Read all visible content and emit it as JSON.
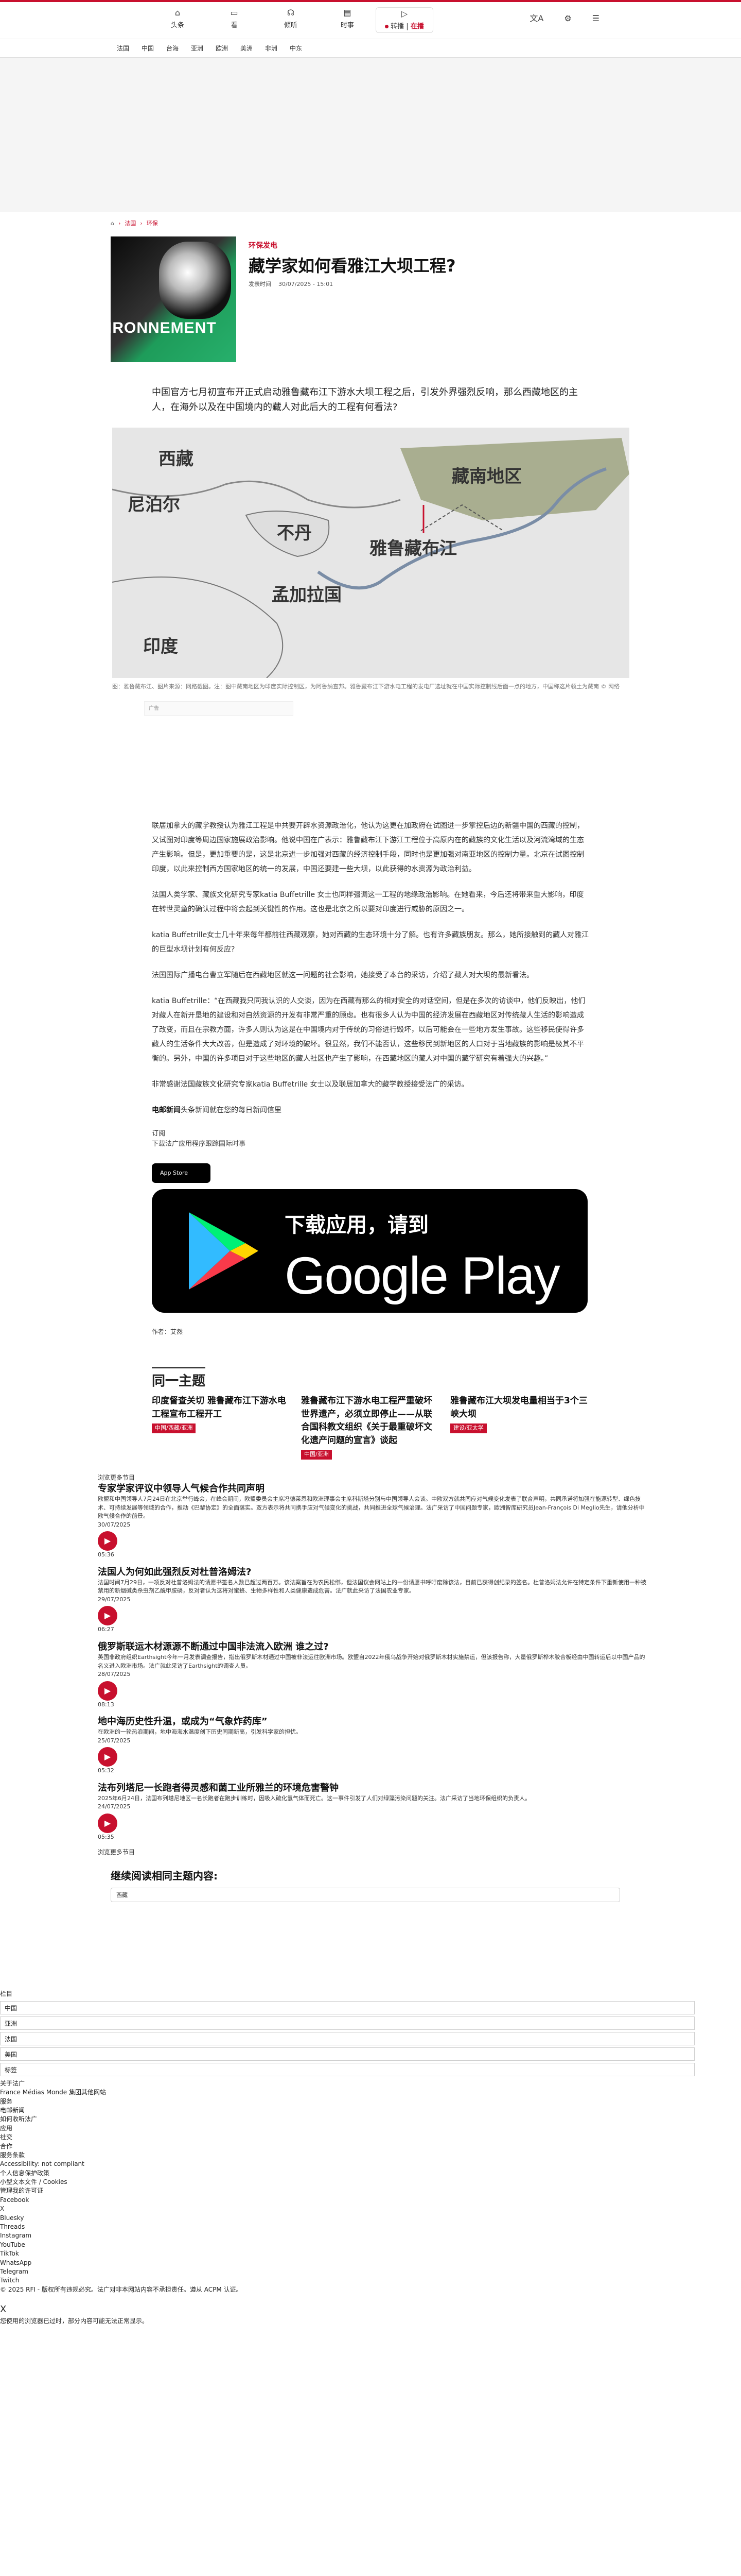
{
  "topnav": {
    "items": [
      {
        "label": "头条",
        "icon": "home-icon"
      },
      {
        "label": "看",
        "icon": "tv-icon"
      },
      {
        "label": "倾听",
        "icon": "headphones-icon"
      },
      {
        "label": "时事",
        "icon": "newspaper-icon"
      }
    ],
    "live_label": "在播",
    "live_prefix": "转播"
  },
  "topright": {
    "lang_icon": "translate-icon",
    "settings_icon": "gear-icon",
    "menu_icon": "hamburger-icon"
  },
  "secnav": [
    "法国",
    "中国",
    "台海",
    "亚洲",
    "欧洲",
    "美洲",
    "非洲",
    "中东"
  ],
  "breadcrumb": {
    "home_icon": "home-icon",
    "items": [
      "法国",
      "环保"
    ]
  },
  "article": {
    "kicker": "环保发电",
    "title": "藏学家如何看雅江大坝工程?",
    "date_label": "发表时间",
    "date": "30/07/2025 - 15:01",
    "thumb_text": "IRONNEMENT",
    "lead": "中国官方七月初宣布开正式启动雅鲁藏布江下游水大坝工程之后，引发外界强烈反响，那么西藏地区的主人，在海外以及在中国境内的藏人对此后大的工程有何看法?",
    "map_labels": [
      "西藏",
      "藏南地区",
      "尼泊尔",
      "不丹",
      "雅鲁藏布江",
      "孟加拉国",
      "印度"
    ],
    "caption": "图：雅鲁藏布江、图片来源：网路截图。注：图中藏南地区为印度实际控制区，为阿鲁纳查邦。雅鲁藏布江下游水电工程的发电厂选址就在中国实际控制线后面一点的地方，中国称这片领土为藏南 © 网络",
    "ad_label": "广告",
    "paragraphs": [
      "联居加拿大的藏学教授认为雅江工程是中共要开辟水资源政治化，他认为这更在加政府在试图进一步掌控后边的新疆中国的西藏的控制，又试图对印度等周边国家施展政治影响。他说中国在广表示：雅鲁藏布江下游江工程位于高原内在的藏族的文化生活以及河流湾域的生态产生影响。但是，更加重要的是，这是北京进一步加强对西藏的经济控制手段，同时也是更加强对南亚地区的控制力量。北京在试图控制印度，以此来控制西方国家地区的统一的发展，中国还要建一些大坝，以此获得的水资源为政治利益。",
      "法国人类学家、藏族文化研究专家katia Buffetrille 女士也同样强调这一工程的地缘政治影响。在她看来，今后还将带来重大影响，印度在转世灵童的确认过程中将会起到关键性的作用。这也是北京之所以要对印度进行威胁的原因之一。",
      "katia Buffetrille女士几十年来每年都前往西藏观察，她对西藏的生态环境十分了解。也有许多藏族朋友。那么，她所接触到的藏人对雅江的巨型水坝计划有何反应?",
      "法国国际广播电台曹立军随后在西藏地区就这一问题的社会影响，她接受了本台的采访，介绍了藏人对大坝的最新看法。"
    ],
    "quote": "katia Buffetrille：“在西藏我只同我认识的人交谈，因为在西藏有那么的相对安全的对话空间，但是在多次的访谈中，他们反映出，他们对藏人在新开垦地的建设和对自然资源的开发有非常严重的顾虑。也有很多人认为中国的经济发展在西藏地区对传统藏人生活的影响造成了改变，而且在宗教方面，许多人则认为这是在中国境内对于传统的习俗进行毁坏，以后可能会在一些地方发生事故。这些移民使得许多藏人的生活条件大大改善，但是造成了对环境的破坏。很显然，我们不能否认，这些移民到新地区的人口对于当地藏族的影响是极其不平衡的。另外，中国的许多项目对于这些地区的藏人社区也产生了影响，在西藏地区的藏人对中国的藏学研究有着强大的兴趣。”",
    "closing": "非常感谢法国藏族文化研究专家katia Buffetrille 女士以及联居加拿大的藏学教授接受法广的采访。",
    "subscribe_prefix": "电邮新闻",
    "subscribe_text": "头条新闻就在您的每日新闻信里",
    "subscribe_link": "订阅",
    "app_download": "下载法广应用程序跟踪国际时事",
    "appstore_label": "App Store",
    "gp_line1": "下载应用，请到",
    "gp_line2": "Google Play",
    "author_label": "作者：",
    "author": "艾然"
  },
  "related": {
    "title": "同一主题",
    "items": [
      {
        "title": "印度督查关切 雅鲁藏布江下游水电工程宣布工程开工",
        "tag": "中国/西藏/亚洲"
      },
      {
        "title": "雅鲁藏布江下游水电工程严重破坏世界遗产，必须立即停止——从联合国科教文组织《关于最重破坏文化遗产问题的宣言》谈起",
        "tag": "中国/亚洲"
      },
      {
        "title": "雅鲁藏布江大坝发电量相当于3个三峡大坝",
        "tag": "建设/亚太学"
      }
    ]
  },
  "podcasts": {
    "header": "浏览更多节目",
    "items": [
      {
        "label": "浏览更多节目",
        "title": "专家学家评议中领导人气候合作共同声明",
        "desc": "欧盟和中国领导人7月24日在北京举行峰会，在峰会期间，欧盟委员会主席冯德莱恩和欧洲理事会主席科斯塔分别与中国领导人会谈。中欧双方就共同应对气候变化发表了联合声明，共同承诺将加强在能源转型、绿色技术、可持续发展等领域的合作，推动《巴黎协定》的全面落实。双方表示将共同携手应对气候变化的挑战，共同推进全球气候治理。法广采访了中国问题专家，欧洲智库研究员Jean-François Di Meglio先生，请他分析中欧气候合作的前景。",
        "date": "30/07/2025",
        "dur": "05:36"
      },
      {
        "label": "",
        "title": "法国人为何如此强烈反对杜普洛姆法?",
        "desc": "法国时间7月29日，一项反对杜普洛姆法的请愿书签名人数已超过两百万。该法案旨在为农民松绑，但法国议会网站上的一份请愿书呼吁废除该法，目前已获得创纪录的签名。杜普洛姆法允许在特定条件下重新使用一种被禁用的新烟碱类杀虫剂乙酰甲胺磷，反对者认为这将对蜜蜂、生物多样性和人类健康造成危害。法广就此采访了法国农业专家。",
        "date": "29/07/2025",
        "dur": "06:27"
      },
      {
        "label": "",
        "title": "俄罗斯联运木材源源不断通过中国非法流入欧洲 谁之过?",
        "desc": "英国非政府组织Earthsight今年一月发表调查报告，指出俄罗斯木材通过中国被非法运往欧洲市场。欧盟自2022年俄乌战争开始对俄罗斯木材实施禁运，但该报告称，大量俄罗斯桦木胶合板经由中国转运后以中国产品的名义进入欧洲市场。法广就此采访了Earthsight的调查人员。",
        "date": "28/07/2025",
        "dur": "08:13"
      },
      {
        "label": "",
        "title": "地中海历史性升温，或成为“气象炸药库”",
        "desc": "在欧洲的一轮热浪期间，地中海海水温度创下历史同期新高，引发科学家的担忧。",
        "date": "25/07/2025",
        "dur": "05:32"
      },
      {
        "label": "",
        "title": "法布列塔尼一长跑者得灵感和菌工业所雅兰的环境危害警钟",
        "desc": "2025年6月24日，法国布列塔尼地区一名长跑者在跑步训练时，因吸入硫化氢气体而死亡。这一事件引发了人们对绿藻污染问题的关注。法广采访了当地环保组织的负责人。",
        "date": "24/07/2025",
        "dur": "05:35"
      }
    ],
    "more": "浏览更多节目"
  },
  "continue": {
    "title": "继续阅读相同主题内容:",
    "field": "西藏"
  },
  "footer": {
    "section_label": "栏目",
    "rows": [
      "中国",
      "亚洲",
      "法国",
      "美国"
    ],
    "tag_label": "标签",
    "lines": [
      "关于法广",
      "France Médias Monde 集团其他网站",
      "服务",
      "电邮新闻",
      "如何收听法广",
      "应用",
      "社交",
      "合作",
      "服务条款",
      "Accessibility: not compliant",
      "个人信息保护政策",
      "小型文本文件 / Cookies",
      "管理我的许可证",
      "Facebook",
      "X",
      "Bluesky",
      "Threads",
      "Instagram",
      "YouTube",
      "TikTok",
      "WhatsApp",
      "Telegram",
      "Twitch"
    ],
    "copyright": "© 2025 RFI - 版权所有违规必究。法广对非本网站内容不承担责任。遵从 ACPM 认证。",
    "close": "X",
    "notice": "您使用的浏览器已过时，部分内容可能无法正常显示。"
  }
}
